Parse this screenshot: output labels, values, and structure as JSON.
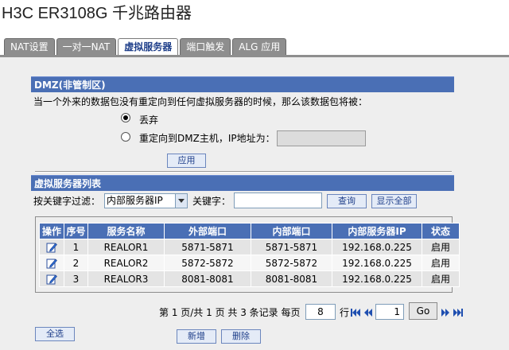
{
  "title": "H3C ER3108G 千兆路由器",
  "tabs": [
    {
      "label": "NAT设置",
      "active": false
    },
    {
      "label": "一对一NAT",
      "active": false
    },
    {
      "label": "虚拟服务器",
      "active": true
    },
    {
      "label": "端口触发",
      "active": false
    },
    {
      "label": "ALG 应用",
      "active": false
    }
  ],
  "dmz": {
    "header": "DMZ(非管制区)",
    "description": "当一个外来的数据包没有重定向到任何虚拟服务器的时候，那么该数据包将被：",
    "option_drop": "丢弃",
    "option_redirect": "重定向到DMZ主机，IP地址为：",
    "selected": "drop",
    "ip_value": "",
    "apply_label": "应用"
  },
  "list": {
    "header": "虚拟服务器列表",
    "filter_label": "按关键字过滤：",
    "filter_selected": "内部服务器IP",
    "keyword_label": "关键字：",
    "keyword_value": "",
    "search_label": "查询",
    "show_all_label": "显示全部",
    "columns": [
      "操作",
      "序号",
      "服务名称",
      "外部端口",
      "内部端口",
      "内部服务器IP",
      "状态"
    ],
    "rows": [
      {
        "index": "1",
        "name": "REALOR1",
        "ext_port": "5871-5871",
        "int_port": "5871-5871",
        "ip": "192.168.0.225",
        "status": "启用"
      },
      {
        "index": "2",
        "name": "REALOR2",
        "ext_port": "5872-5872",
        "int_port": "5872-5872",
        "ip": "192.168.0.225",
        "status": "启用"
      },
      {
        "index": "3",
        "name": "REALOR3",
        "ext_port": "8081-8081",
        "int_port": "8081-8081",
        "ip": "192.168.0.225",
        "status": "启用"
      }
    ]
  },
  "pager": {
    "summary": "第 1 页/共 1 页 共 3 条记录 每页",
    "per_page": "8",
    "rows_unit": "行",
    "page_input": "1",
    "go_label": "Go"
  },
  "actions": {
    "select_all": "全选",
    "add": "新增",
    "delete": "删除"
  },
  "colors": {
    "header_blue": "#4a6fb5",
    "tab_grey": "#8e8e8e",
    "panel_bg": "#eeeeee",
    "pager_arrow": "#1f4fb0"
  },
  "icons": [
    "edit-icon",
    "first-page-icon",
    "prev-page-icon",
    "next-page-icon",
    "last-page-icon"
  ]
}
